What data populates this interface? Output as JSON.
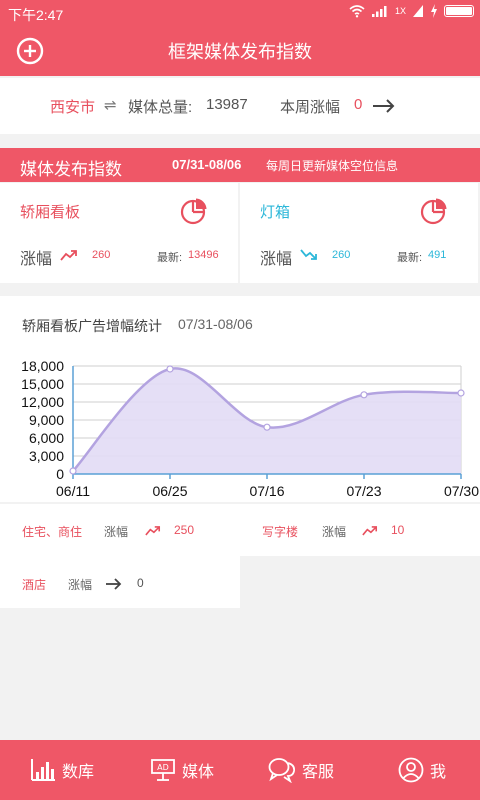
{
  "status": {
    "time": "下午2:47",
    "net": "1X"
  },
  "appbar": {
    "title": "框架媒体发布指数"
  },
  "cityrow": {
    "city": "西安市",
    "swap": "⇌",
    "total_label": "媒体总量:",
    "total_value": "13987",
    "weekly_label": "本周涨幅",
    "weekly_value": "0"
  },
  "section": {
    "title": "媒体发布指数",
    "date": "07/31-08/06",
    "note": "每周日更新媒体空位信息"
  },
  "cards": [
    {
      "name": "轿厢看板",
      "change_label": "涨幅",
      "change_value": "260",
      "latest_label": "最新:",
      "latest_value": "13496",
      "color": "#e8505e"
    },
    {
      "name": "灯箱",
      "change_label": "涨幅",
      "change_value": "260",
      "latest_label": "最新:",
      "latest_value": "491",
      "color": "#2cb7d9"
    }
  ],
  "chart_section": {
    "title": "轿厢看板广告增幅统计",
    "date": "07/31-08/06"
  },
  "chart_data": {
    "type": "area",
    "title": "",
    "x": [
      "06/11",
      "06/25",
      "07/16",
      "07/23",
      "07/30"
    ],
    "values": [
      500,
      17500,
      7800,
      13200,
      13500
    ],
    "ylim": [
      0,
      18000
    ],
    "yticks": [
      "0",
      "3,000",
      "6,000",
      "9,000",
      "12,000",
      "15,000",
      "18,000"
    ],
    "grid": true,
    "legend": "none",
    "line_color": "#b3a3e0",
    "fill_color": "#e2dbf5"
  },
  "stats": [
    {
      "name": "住宅、商住",
      "label": "涨幅",
      "value": "250",
      "trend": "up"
    },
    {
      "name": "写字楼",
      "label": "涨幅",
      "value": "10",
      "trend": "up"
    },
    {
      "name": "酒店",
      "label": "涨幅",
      "value": "0",
      "trend": "flat"
    }
  ],
  "nav": [
    {
      "label": "数库",
      "icon": "bar-chart-icon"
    },
    {
      "label": "媒体",
      "icon": "ad-board-icon"
    },
    {
      "label": "客服",
      "icon": "chat-bubbles-icon"
    },
    {
      "label": "我",
      "icon": "user-icon"
    }
  ],
  "colors": {
    "brand": "#ef5767",
    "accent_red": "#e8505e",
    "accent_cyan": "#2cb7d9"
  }
}
